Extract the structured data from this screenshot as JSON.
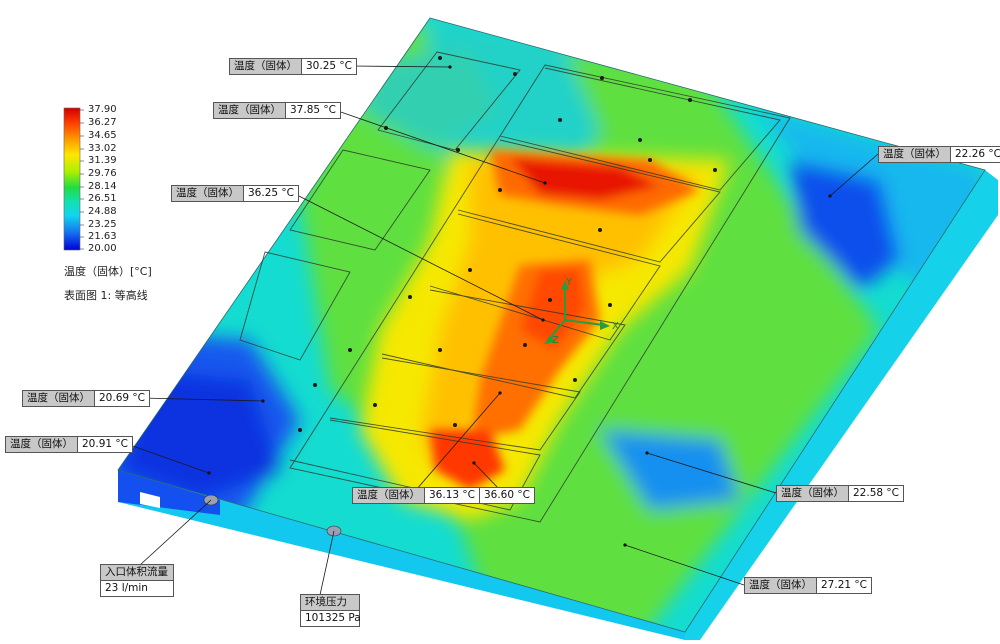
{
  "legend": {
    "ticks": [
      "37.90",
      "36.27",
      "34.65",
      "33.02",
      "31.39",
      "29.76",
      "28.14",
      "26.51",
      "24.88",
      "23.25",
      "21.63",
      "20.00"
    ],
    "quantity_label": "温度（固体）[°C]",
    "plot_label": "表面图 1: 等高线",
    "colors": [
      "#d00000",
      "#ff3a00",
      "#ff8a00",
      "#ffd200",
      "#e6f000",
      "#9ae600",
      "#2fd83a",
      "#19e08a",
      "#12dcd0",
      "#10b4f0",
      "#1462ee",
      "#0000d8"
    ]
  },
  "probe_label": "温度（固体）",
  "probes": [
    {
      "id": "p1",
      "value": "30.25 °C"
    },
    {
      "id": "p2",
      "value": "37.85 °C"
    },
    {
      "id": "p3",
      "value": "36.25 °C"
    },
    {
      "id": "p4",
      "value": "22.26 °C"
    },
    {
      "id": "p5",
      "value": "20.69 °C"
    },
    {
      "id": "p6",
      "value": "20.91 °C"
    },
    {
      "id": "p7",
      "value": "36.13 °C"
    },
    {
      "id": "p8",
      "value": "36.60 °C"
    },
    {
      "id": "p9",
      "value": "22.58 °C"
    },
    {
      "id": "p10",
      "value": "27.21 °C"
    }
  ],
  "goals": {
    "inlet": {
      "label": "入口体积流量",
      "value": "23 l/min"
    },
    "ambient": {
      "label": "环境压力",
      "value": "101325 Pa"
    }
  },
  "triad": {
    "x": "X",
    "y": "Y",
    "z": "Z"
  }
}
